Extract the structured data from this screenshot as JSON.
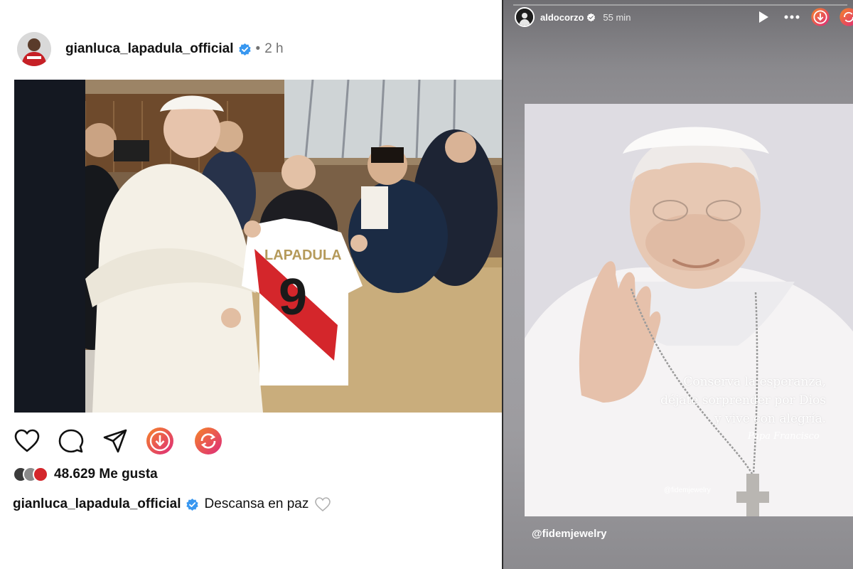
{
  "post": {
    "username": "gianluca_lapadula_official",
    "separator": "•",
    "time": "2 h",
    "likes_text": "48.629 Me gusta",
    "caption_user": "gianluca_lapadula_official",
    "caption_text": "Descansa en paz",
    "photo_text": {
      "jersey_name": "LAPADULA",
      "jersey_number": "9"
    },
    "action_icons": [
      "heart-icon",
      "comment-icon",
      "share-icon",
      "download-icon",
      "repost-icon"
    ],
    "colors": {
      "verified": "#3897f0",
      "download_gradient_start": "#f58529",
      "download_gradient_end": "#dd2a7b",
      "jersey_red": "#d4262b"
    }
  },
  "story": {
    "username": "aldocorzo",
    "time": "55 min",
    "quote_lines": [
      "Conserva la esperanza,",
      "déjate sorprender por Dios",
      "y vive con alegría."
    ],
    "signature": "Papa Francisco",
    "watermark": "@fidemjewelry",
    "mention": "@fidemjewelry",
    "control_icons": [
      "play-icon",
      "more-icon",
      "download-icon",
      "repost-icon"
    ]
  }
}
